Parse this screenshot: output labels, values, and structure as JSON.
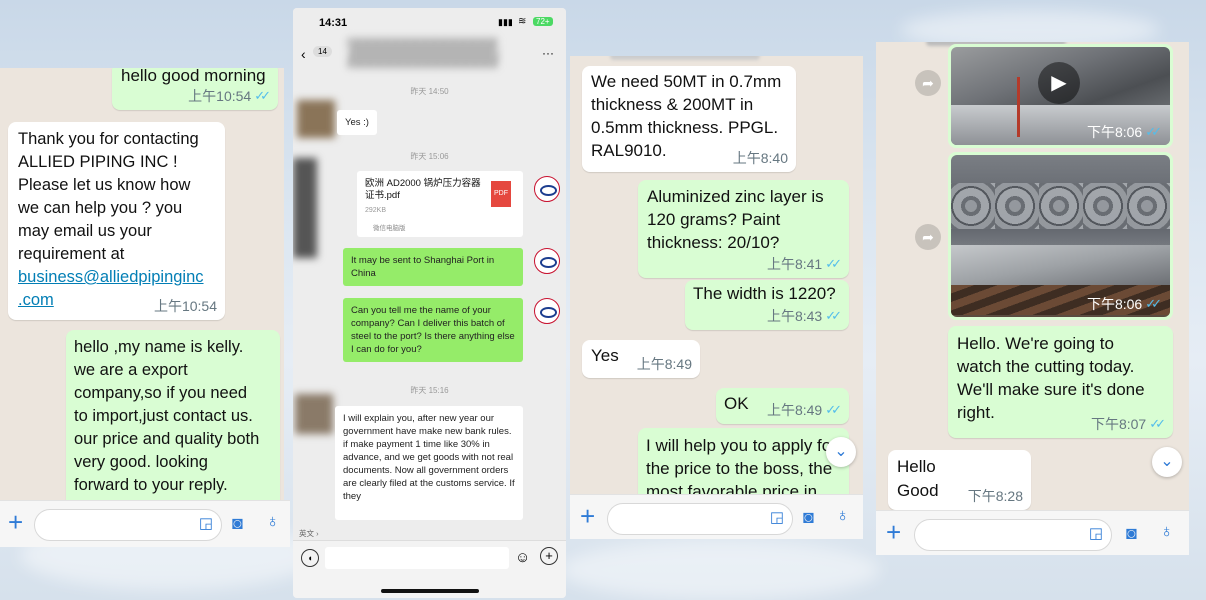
{
  "panel1": {
    "messages": [
      {
        "dir": "out",
        "text": "hello good morning",
        "time": "上午10:54",
        "ticks": "✓✓"
      },
      {
        "dir": "in",
        "text": "Thank you for contacting\nALLIED PIPING INC !\nPlease let us know how\nwe can help you ? you\nmay email us your\nrequirement at",
        "link": "business@alliedpipinginc\n.com",
        "time": "上午10:54"
      },
      {
        "dir": "out",
        "text": "hello ,my name is kelly.\nwe are a export\ncompany,so if you need\nto import,just contact us.\nour price and quality both\nvery good.   looking\nforward to your reply.\nthank you"
      }
    ]
  },
  "panel2": {
    "status_time": "14:31",
    "battery": "72+",
    "back_count": "14",
    "more": "···",
    "times": [
      "昨天 14:50",
      "昨天 15:06",
      "昨天 15:16"
    ],
    "messages": [
      {
        "dir": "in",
        "text": "Yes :)"
      },
      {
        "dir": "out",
        "file_name": "欧洲 AD2000 锅炉压力容器证书.pdf",
        "file_size": "292KB",
        "file_badge": "PDF",
        "file_source": "微信电脑版"
      },
      {
        "dir": "out",
        "text": "It may be sent to Shanghai Port in China"
      },
      {
        "dir": "out",
        "text": "Can you tell me the name of your company? Can I deliver this batch of steel to the port? Is there anything else I can do for you?"
      },
      {
        "dir": "in",
        "text": "I will explain you, after new year our  government have make new bank rules.\nif make payment 1 time like 30% in advance, and we get goods with not real documents. Now all government orders are clearly filed at the customs service. If they"
      }
    ],
    "translate_label": "英文 ›"
  },
  "panel3": {
    "messages": [
      {
        "dir": "in",
        "text": "We need 50MT in 0.7mm\nthickness & 200MT in\n0.5mm thickness. PPGL.\nRAL9010.",
        "time": "上午8:40"
      },
      {
        "dir": "out",
        "text": "Aluminized zinc layer is\n120 grams? Paint\nthickness: 20/10?",
        "time": "上午8:41",
        "ticks": "✓✓"
      },
      {
        "dir": "out",
        "text": "The width is 1220?",
        "time": "上午8:43",
        "ticks": "✓✓"
      },
      {
        "dir": "in",
        "text": "Yes",
        "time": "上午8:49"
      },
      {
        "dir": "out",
        "text": "OK",
        "time": "上午8:49",
        "ticks": "✓✓"
      },
      {
        "dir": "out",
        "text": "I will help you to apply for\nthe price to the boss, the\nmost favorable price in"
      }
    ]
  },
  "panel4": {
    "messages": [
      {
        "dir": "out",
        "kind": "video",
        "time": "下午8:06",
        "ticks": "✓✓"
      },
      {
        "dir": "out",
        "kind": "image",
        "time": "下午8:06",
        "ticks": "✓✓"
      },
      {
        "dir": "out",
        "text": "Hello. We're going to\nwatch the cutting today.\nWe'll make sure it's done\nright.",
        "time": "下午8:07",
        "ticks": "✓✓"
      },
      {
        "dir": "in",
        "text": "Hello\nGood",
        "time": "下午8:28"
      }
    ]
  },
  "colors": {
    "incoming": "#ffffff",
    "outgoing": "#d9fdd3",
    "wechat_outgoing": "#95ec69",
    "tick": "#53bdeb",
    "accent": "#2f7bd6",
    "link": "#027eb5"
  },
  "icons": {
    "plus": "plus-icon",
    "sticker": "sticker-icon",
    "camera": "camera-icon",
    "mic": "microphone-icon",
    "forward": "forward-icon",
    "scroll": "chevron-down-icon",
    "play": "play-icon"
  }
}
